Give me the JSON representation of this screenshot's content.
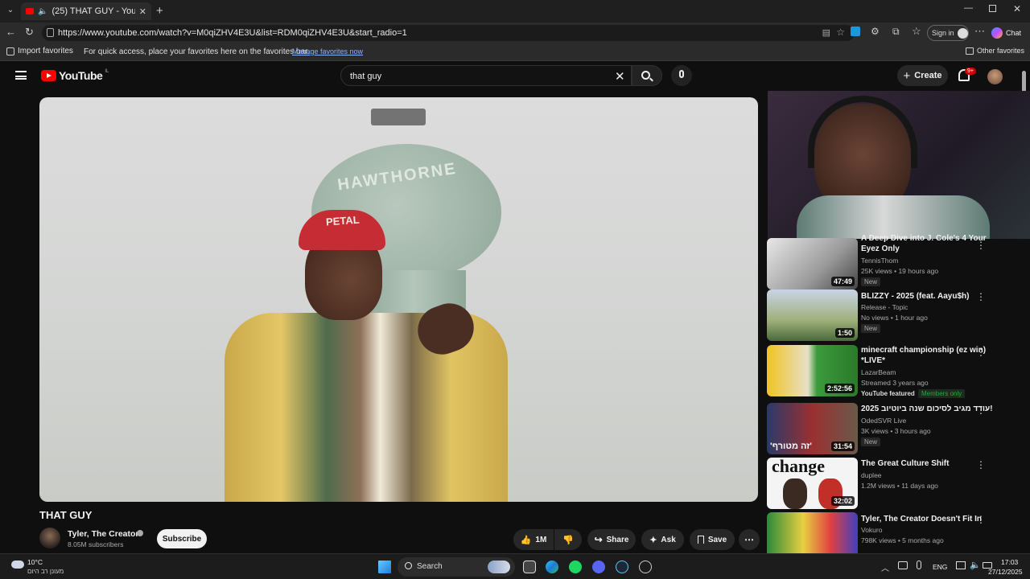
{
  "browser": {
    "tab_title": "(25) THAT GUY - YouTube",
    "url": "https://www.youtube.com/watch?v=M0qiZHV4E3U&list=RDM0qiZHV4E3U&start_radio=1",
    "sign_in": "Sign in",
    "chat": "Chat",
    "import_favorites": "Import favorites",
    "fav_hint": "For quick access, place your favorites here on the favorites bar.",
    "manage_favorites": "Manage favorites now",
    "other_favorites": "Other favorites"
  },
  "youtube": {
    "logo": "YouTube",
    "logo_region": "IL",
    "search_value": "that guy",
    "create": "Create",
    "notif_badge": "9+",
    "video_title": "THAT GUY",
    "channel": "Tyler, The Creator",
    "subscribers": "8.05M subscribers",
    "subscribe": "Subscribe",
    "likes": "1M",
    "share": "Share",
    "ask": "Ask",
    "save": "Save",
    "hat_text": "PETAL",
    "tower_text": "HAWTHORNE"
  },
  "recs": [
    {
      "title": "A Deep Dive into J. Cole's 4 Your Eyez Only",
      "channel": "TennisThom",
      "meta": "25K views • 19 hours ago",
      "badge": "New",
      "duration": "47:49",
      "verified": true
    },
    {
      "title": "BLIZZY - 2025 (feat. Aayu$h)",
      "channel": "Release - Topic",
      "meta": "No views • 1 hour ago",
      "badge": "New",
      "duration": "1:50",
      "verified": false
    },
    {
      "title": "minecraft championship (ez win) *LIVE*",
      "channel": "LazarBeam",
      "meta": "Streamed 3 years ago",
      "badge": "YouTube featured",
      "members": "Members only",
      "duration": "2:52:56",
      "verified": true
    },
    {
      "title": "עודד מגיב לסיכום שנה ביוטיוב 2025!",
      "channel": "OdedSVR Live",
      "meta": "3K views • 3 hours ago",
      "badge": "New",
      "duration": "31:54",
      "thumb_text": "'זה מטורף'",
      "verified": false
    },
    {
      "title": "The Great Culture Shift",
      "channel": "duplee",
      "meta": "1.2M views • 11 days ago",
      "duration": "32:02",
      "thumb_text": "change",
      "verified": true
    },
    {
      "title": "Tyler, The Creator Doesn't Fit In",
      "channel": "Vokuro",
      "meta": "798K views • 5 months ago",
      "verified": false
    }
  ],
  "taskbar": {
    "temp": "10°C",
    "weather": "מעונן רב היום",
    "search": "Search",
    "lang": "ENG",
    "time": "17:03",
    "date": "27/12/2025"
  },
  "colors": {
    "yt_red": "#ff0000",
    "bg": "#0f0f0f",
    "accent": "#3ea6ff",
    "members": "#2ba640"
  }
}
